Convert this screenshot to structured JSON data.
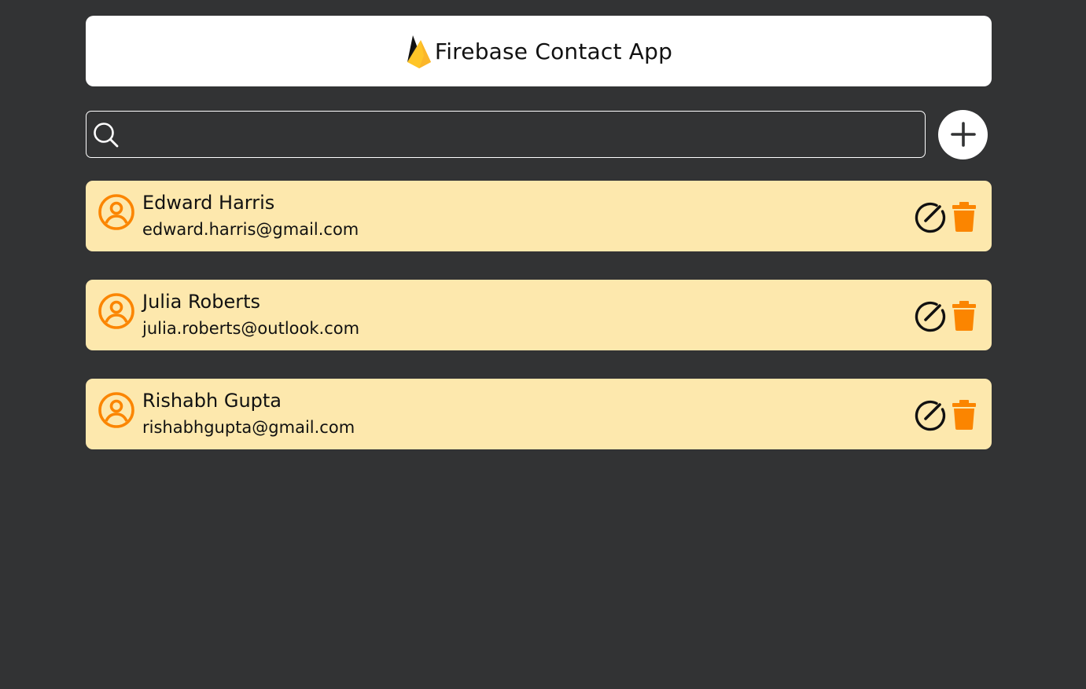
{
  "header": {
    "title": "Firebase Contact App",
    "logo_icon": "firebase-flame-icon"
  },
  "search": {
    "placeholder": "",
    "value": "",
    "icon": "search-icon"
  },
  "add_button": {
    "icon": "plus-icon"
  },
  "colors": {
    "background": "#323334",
    "card": "#fde8ad",
    "accent": "#fb8500",
    "header": "#ffffff"
  },
  "contacts": [
    {
      "name": "Edward Harris",
      "email": "edward.harris@gmail.com"
    },
    {
      "name": "Julia Roberts",
      "email": "julia.roberts@outlook.com"
    },
    {
      "name": "Rishabh Gupta",
      "email": "rishabhgupta@gmail.com"
    }
  ]
}
